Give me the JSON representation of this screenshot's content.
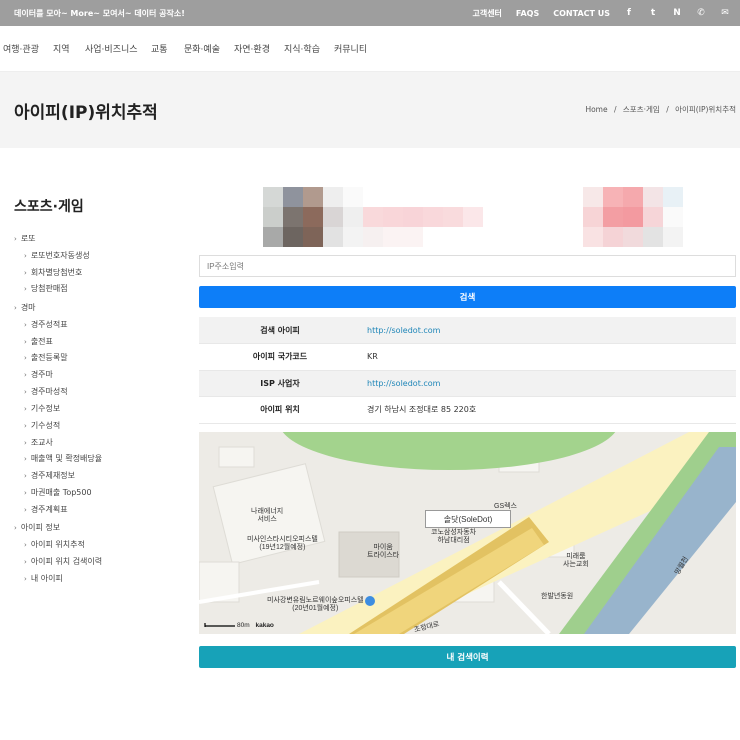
{
  "topbar": {
    "tagline": "데이터를 모아~ More~ 모여서~ 데이터 공작소!",
    "links": [
      "고객센터",
      "FAQS",
      "CONTACT US"
    ],
    "icons": [
      "facebook-icon",
      "twitter-icon",
      "naver-icon",
      "phone-icon",
      "mail-icon"
    ],
    "icon_glyphs": [
      "f",
      "t",
      "N",
      "✆",
      "✉"
    ]
  },
  "nav": {
    "items": [
      "여행·관광",
      "지역",
      "사업·비즈니스",
      "교통",
      "문화·예술",
      "자연·환경",
      "지식·학습",
      "커뮤니티"
    ]
  },
  "page": {
    "title": "아이피(IP)위치추적",
    "breadcrumb": {
      "home": "Home",
      "sep": "/",
      "section": "스포츠·게임",
      "current": "아이피(IP)위치추적"
    }
  },
  "sidebar": {
    "title": "스포츠·게임",
    "groups": [
      {
        "label": "로또",
        "items": [
          "로또번호자동생성",
          "회차별당첨번호",
          "당첨판매점"
        ]
      },
      {
        "label": "경마",
        "items": [
          "경주성적표",
          "출전표",
          "출전등록말",
          "경주마",
          "경주마성적",
          "기수정보",
          "기수성적",
          "조교사",
          "매출액 및 확정배당율",
          "경주제재정보",
          "마권매출 Top500",
          "경주계획표"
        ]
      },
      {
        "label": "아이피 정보",
        "items": [
          "아이피 위치추적",
          "아이피 위치 검색이력",
          "내 아이피"
        ]
      }
    ]
  },
  "search": {
    "placeholder": "IP주소입력",
    "button_label": "검색"
  },
  "result": {
    "rows": [
      {
        "key": "검색 아이피",
        "value": "http://soledot.com",
        "link": true
      },
      {
        "key": "아이피 국가코드",
        "value": "KR",
        "link": false
      },
      {
        "key": "ISP 사업자",
        "value": "http://soledot.com",
        "link": true
      },
      {
        "key": "아이피 위치",
        "value": "경기 하남시 조정대로 85 220호",
        "link": false
      }
    ]
  },
  "map": {
    "marker_label": "솔닷(SoleDot)",
    "labels": [
      "나래에너지\n서비스",
      "미사인스타시티오피스텔\n(19년12월예정)",
      "마이움\n트라이스타",
      "코노삼성자동차\n하남대리점",
      "GS렉스",
      "미래룸\n사는교회",
      "미사강변유림노르웨이숲오피스텔\n(20년01월예정)",
      "한발년동원",
      "조정대로",
      "망월천"
    ],
    "scale_text": "80m",
    "logo_text": "kakao"
  },
  "history_button_label": "내 검색이력",
  "colors": {
    "primary": "#0d7ef8",
    "secondary": "#17a2b8",
    "topbar": "#9e9e9e",
    "link": "#1f86b8"
  }
}
